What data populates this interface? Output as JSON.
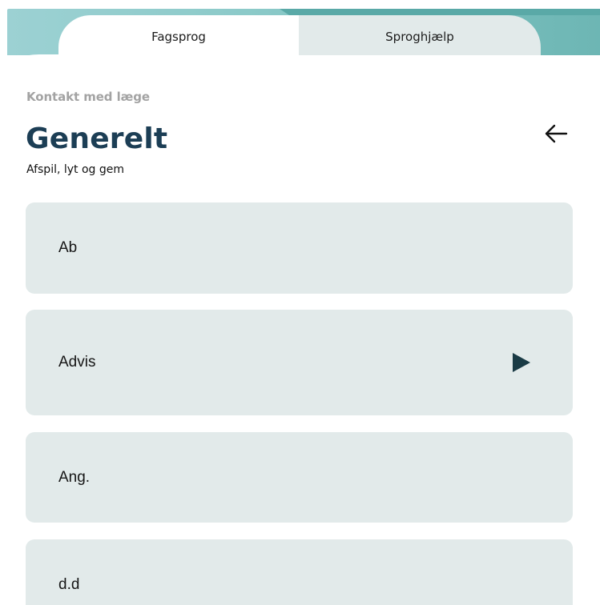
{
  "tabs": [
    {
      "label": "Fagsprog",
      "active": true
    },
    {
      "label": "Sproghjælp",
      "active": false
    }
  ],
  "header": {
    "breadcrumb": "Kontakt med læge",
    "title": "Generelt",
    "subtitle": "Afspil, lyt og gem",
    "back_icon": "arrow-left-icon"
  },
  "items": [
    {
      "label": "Ab",
      "has_play": false
    },
    {
      "label": "Advis",
      "has_play": true
    },
    {
      "label": "Ang.",
      "has_play": false
    },
    {
      "label": "d.d",
      "has_play": false
    }
  ],
  "colors": {
    "accent_teal": "#7bc0be",
    "title_navy": "#1c3e55",
    "item_background": "#e2eaea",
    "play_icon": "#1a3b45",
    "breadcrumb_gray": "#a3a3a3"
  }
}
